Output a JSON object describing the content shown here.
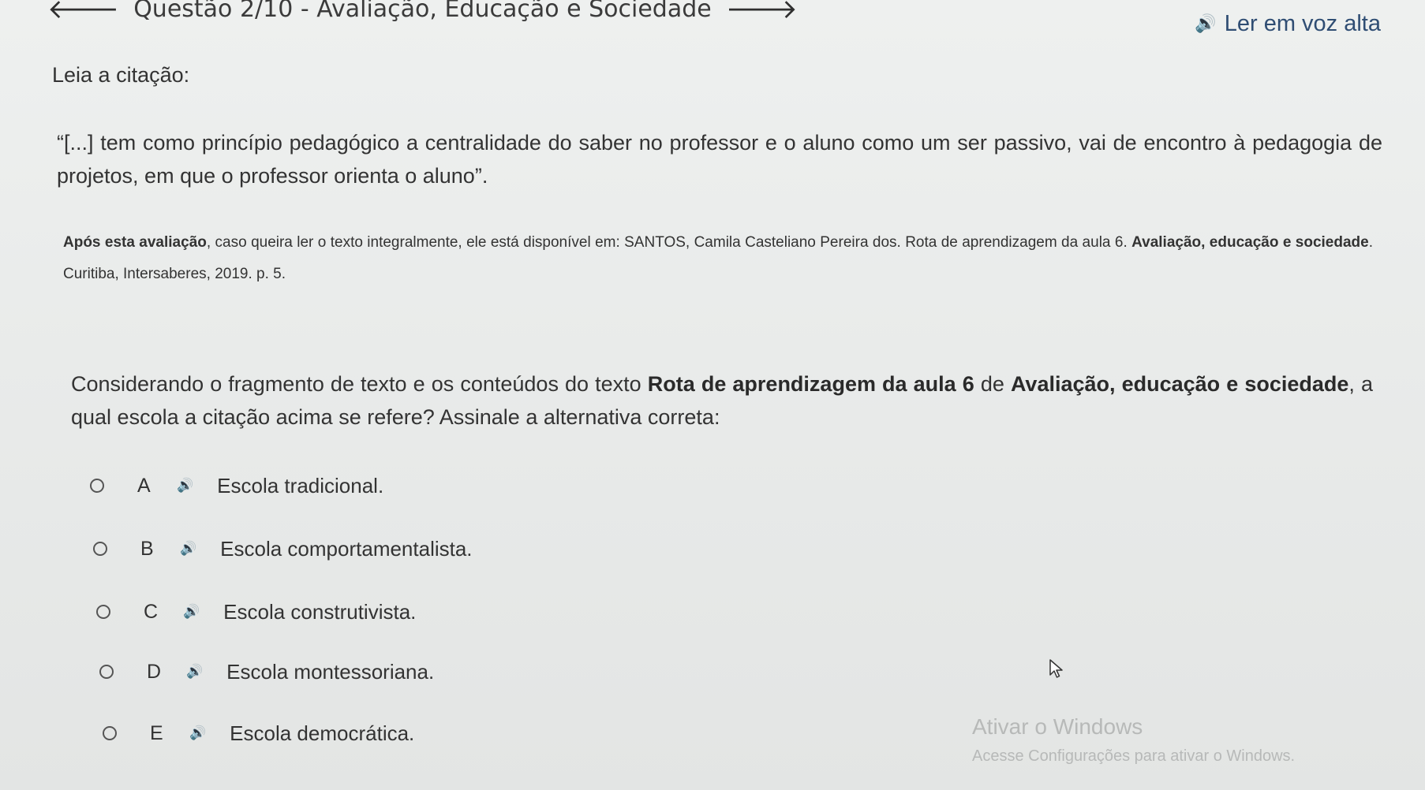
{
  "header": {
    "title": "Questão 2/10 - Avaliação, Educação e Sociedade",
    "back_icon": "arrow-left-icon",
    "next_icon": "arrow-right-icon"
  },
  "read_aloud": {
    "label": "Ler em voz alta",
    "icon": "speaker-icon"
  },
  "content": {
    "intro": "Leia a citação:",
    "quote": "“[...] tem como princípio pedagógico a centralidade do saber no professor e o aluno como um ser passivo, vai de encontro à pedagogia de projetos, em que o professor orienta o aluno”.",
    "source_prefix": "Após esta avaliação",
    "source_text": ", caso queira ler o texto integralmente, ele está disponível em: SANTOS, Camila Casteliano Pereira dos. Rota de aprendizagem da aula 6. ",
    "source_book": "Avaliação, educação e sociedade",
    "source_suffix": ". Curitiba, Intersaberes, 2019. p. 5.",
    "question_1": "Considerando o fragmento de texto e os conteúdos do texto ",
    "question_bold_1": "Rota de aprendizagem da aula 6",
    "question_2": " de ",
    "question_bold_2": "Avaliação, educação e sociedade",
    "question_3": ", a qual escola a citação acima se refere? Assinale a alternativa correta:"
  },
  "options": [
    {
      "letter": "A",
      "text": "Escola tradicional."
    },
    {
      "letter": "B",
      "text": "Escola comportamentalista."
    },
    {
      "letter": "C",
      "text": "Escola construtivista."
    },
    {
      "letter": "D",
      "text": "Escola montessoriana."
    },
    {
      "letter": "E",
      "text": "Escola democrática."
    }
  ],
  "watermark": {
    "title": "Ativar o Windows",
    "subtitle": "Acesse Configurações para ativar o Windows."
  }
}
